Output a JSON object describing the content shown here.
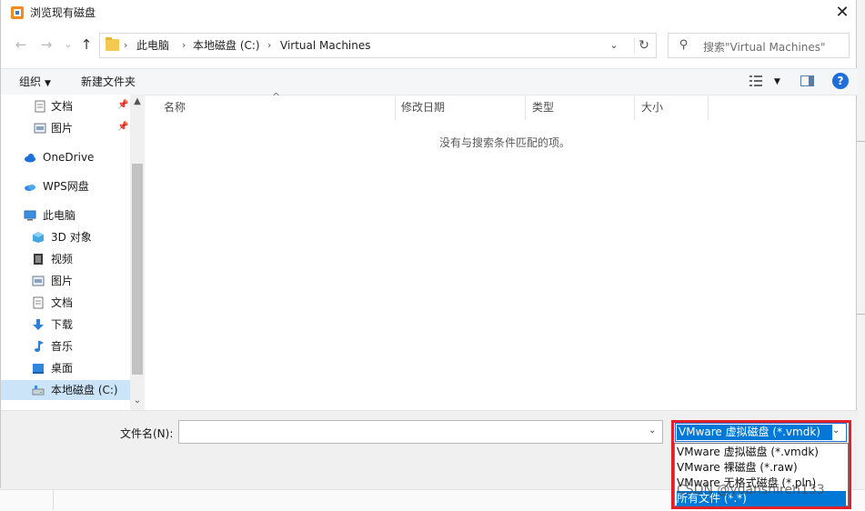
{
  "window": {
    "title": "浏览现有磁盘",
    "close_glyph": "✕"
  },
  "nav": {
    "back": "←",
    "forward": "→",
    "recent": "⌄",
    "up": "↑"
  },
  "address": {
    "crumbs": [
      "此电脑",
      "本地磁盘 (C:)",
      "Virtual Machines"
    ],
    "separator": "›",
    "dropdown": "⌄",
    "refresh": "↻"
  },
  "search": {
    "placeholder": "搜索\"Virtual Machines\""
  },
  "toolbar": {
    "organize": "组织",
    "new_folder": "新建文件夹",
    "help": "?"
  },
  "sidebar": {
    "items": [
      {
        "label": "文档",
        "icon": "document-icon",
        "pinned": true
      },
      {
        "label": "图片",
        "icon": "pictures-icon",
        "pinned": true
      },
      {
        "label": "OneDrive",
        "icon": "cloud-icon"
      },
      {
        "label": "WPS网盘",
        "icon": "wps-cloud-icon"
      },
      {
        "label": "此电脑",
        "icon": "computer-icon"
      },
      {
        "label": "3D 对象",
        "icon": "3d-objects-icon"
      },
      {
        "label": "视频",
        "icon": "video-icon"
      },
      {
        "label": "图片",
        "icon": "pictures-icon"
      },
      {
        "label": "文档",
        "icon": "document-icon"
      },
      {
        "label": "下载",
        "icon": "download-icon"
      },
      {
        "label": "音乐",
        "icon": "music-icon"
      },
      {
        "label": "桌面",
        "icon": "desktop-icon"
      },
      {
        "label": "本地磁盘 (C:)",
        "icon": "drive-icon",
        "selected": true
      }
    ]
  },
  "filelist": {
    "columns": [
      "名称",
      "修改日期",
      "类型",
      "大小"
    ],
    "empty_message": "没有与搜索条件匹配的项。"
  },
  "bottom": {
    "filename_label": "文件名(N):",
    "filename_value": "",
    "filter_selected": "VMware 虚拟磁盘 (*.vmdk)",
    "filter_options": [
      "VMware 虚拟磁盘 (*.vmdk)",
      "VMware 裸磁盘 (*.raw)",
      "VMware 无格式磁盘 (*.pln)",
      "所有文件 (*.*)"
    ]
  },
  "watermark": "CSDN @yuanshiren133",
  "colors": {
    "accent": "#0078d7",
    "highlight_frame": "#e2202a",
    "selected_nav": "#cce4f7"
  }
}
